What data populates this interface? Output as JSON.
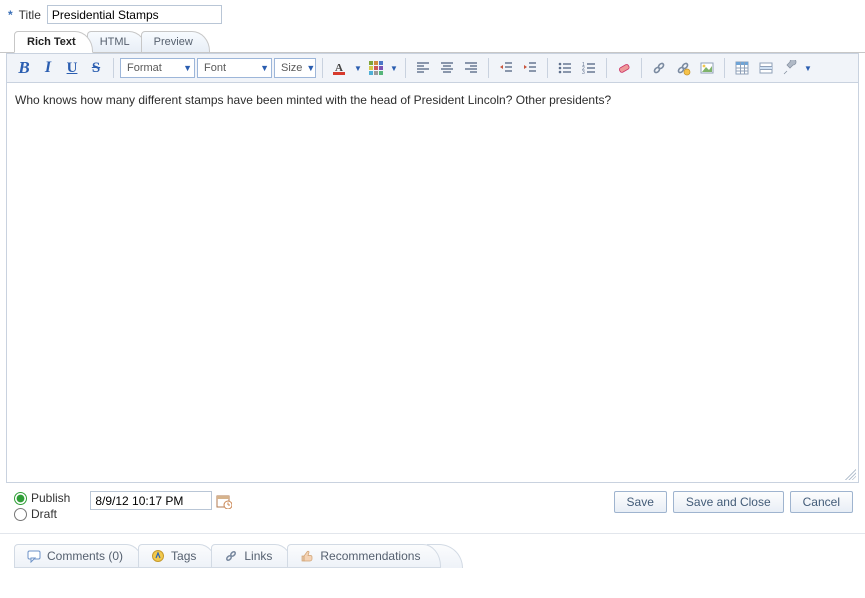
{
  "title": {
    "label": "Title",
    "value": "Presidential Stamps"
  },
  "tabs": {
    "rich": "Rich Text",
    "html": "HTML",
    "preview": "Preview",
    "active": "rich"
  },
  "toolbar": {
    "format": "Format",
    "font": "Font",
    "size": "Size"
  },
  "content": "Who knows how many different stamps have been minted with the head of President Lincoln?  Other presidents?",
  "publish": {
    "publish_label": "Publish",
    "draft_label": "Draft",
    "selected": "publish",
    "datetime": "8/9/12 10:17 PM"
  },
  "buttons": {
    "save": "Save",
    "save_close": "Save and Close",
    "cancel": "Cancel"
  },
  "bottom_tabs": {
    "comments": "Comments (0)",
    "tags": "Tags",
    "links": "Links",
    "recommendations": "Recommendations"
  }
}
